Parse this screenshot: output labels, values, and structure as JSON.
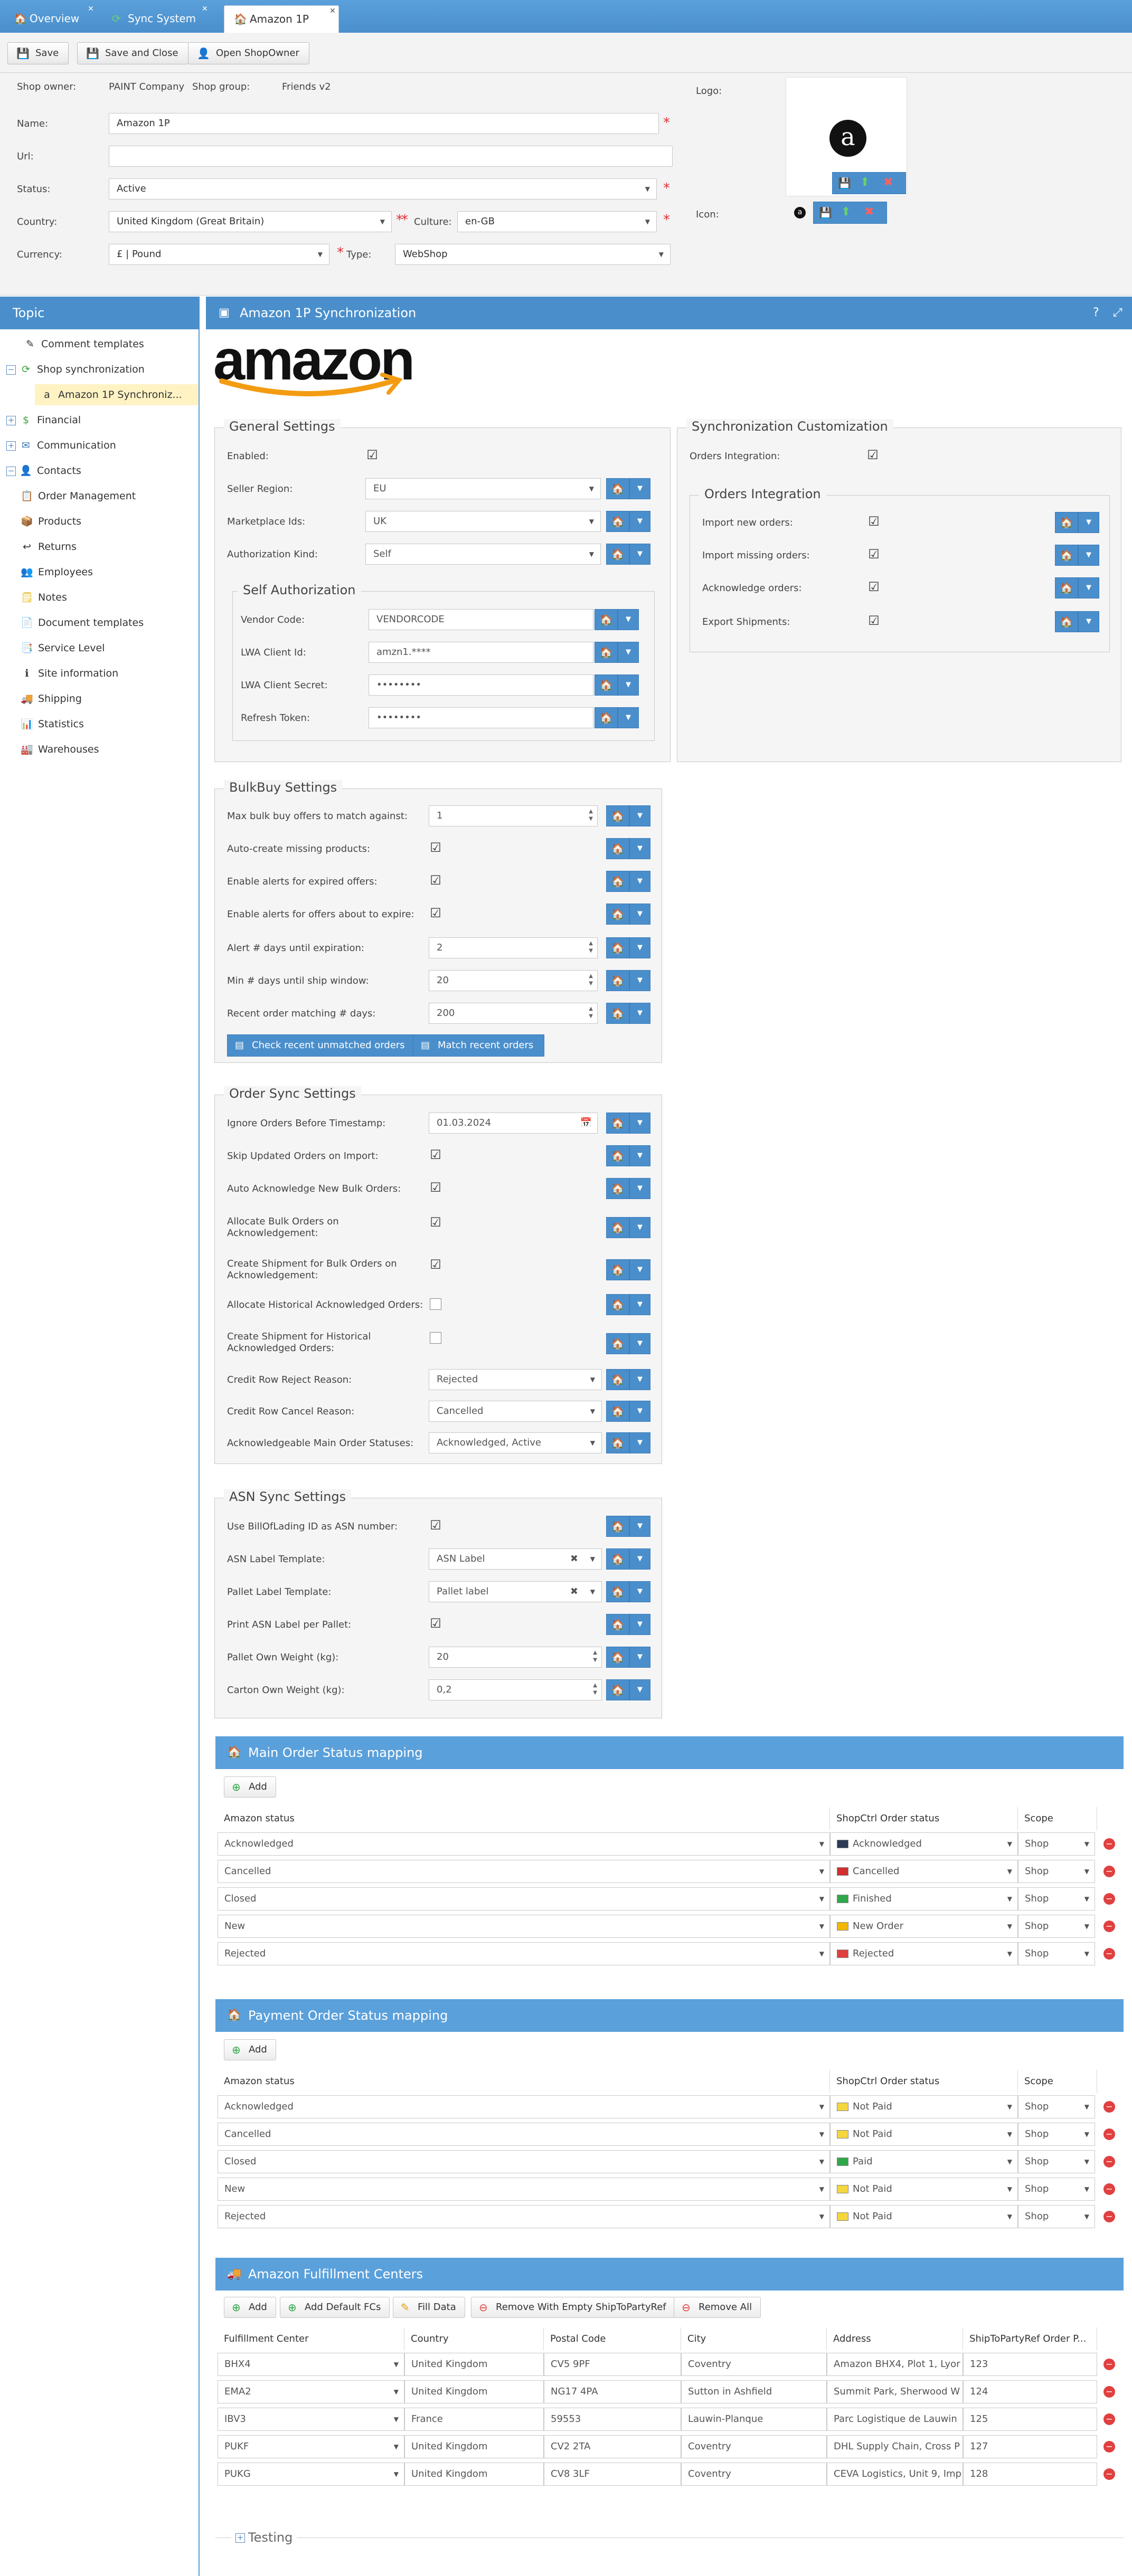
{
  "tabs": [
    {
      "label": "Overview",
      "icon": "home-icon"
    },
    {
      "label": "Sync System",
      "icon": "sync-icon"
    },
    {
      "label": "Amazon 1P",
      "icon": "home-icon"
    }
  ],
  "toolbar": {
    "save": "Save",
    "save_close": "Save and Close",
    "open_owner": "Open ShopOwner"
  },
  "header": {
    "shop_owner_label": "Shop owner:",
    "shop_owner": "PAINT Company",
    "shop_group_label": "Shop group:",
    "shop_group": "Friends v2",
    "name_label": "Name:",
    "name": "Amazon 1P",
    "url_label": "Url:",
    "url": "",
    "status_label": "Status:",
    "status": "Active",
    "country_label": "Country:",
    "country": "United Kingdom (Great Britain)",
    "culture_label": "Culture:",
    "culture": "en-GB",
    "currency_label": "Currency:",
    "currency": "£ | Pound",
    "type_label": "Type:",
    "type": "WebShop",
    "logo_label": "Logo:",
    "icon_label": "Icon:"
  },
  "sidebar": {
    "title": "Topic",
    "items": [
      {
        "label": "Comment templates"
      },
      {
        "label": "Shop synchronization"
      },
      {
        "label": "Amazon 1P Synchroniz..."
      },
      {
        "label": "Financial"
      },
      {
        "label": "Communication"
      },
      {
        "label": "Contacts"
      },
      {
        "label": "Order Management"
      },
      {
        "label": "Products"
      },
      {
        "label": "Returns"
      },
      {
        "label": "Employees"
      },
      {
        "label": "Notes"
      },
      {
        "label": "Document templates"
      },
      {
        "label": "Service Level"
      },
      {
        "label": "Site information"
      },
      {
        "label": "Shipping"
      },
      {
        "label": "Statistics"
      },
      {
        "label": "Warehouses"
      }
    ]
  },
  "main": {
    "title": "Amazon 1P Synchronization",
    "logo_text": "amazon",
    "general": {
      "legend": "General Settings",
      "enabled": "Enabled:",
      "seller_region": "Seller Region:",
      "seller_region_val": "EU",
      "marketplace": "Marketplace Ids:",
      "marketplace_val": "UK",
      "auth_kind": "Authorization Kind:",
      "auth_kind_val": "Self",
      "self_legend": "Self Authorization",
      "vendor": "Vendor Code:",
      "vendor_val": "VENDORCODE",
      "lwa_id": "LWA Client Id:",
      "lwa_id_val": "amzn1.****",
      "lwa_secret": "LWA Client Secret:",
      "lwa_secret_val": "••••••••",
      "refresh": "Refresh Token:",
      "refresh_val": "••••••••"
    },
    "sync_custom": {
      "legend": "Synchronization Customization",
      "orders_integration": "Orders Integration:",
      "oi_legend": "Orders Integration",
      "import_new": "Import new orders:",
      "import_missing": "Import missing orders:",
      "acknowledge": "Acknowledge orders:",
      "export_ship": "Export Shipments:"
    },
    "bulk": {
      "legend": "BulkBuy Settings",
      "max_offers": "Max bulk buy offers to match against:",
      "max_offers_val": "1",
      "auto_create": "Auto-create missing products:",
      "alert_expired": "Enable alerts for expired offers:",
      "alert_expire": "Enable alerts for offers about to expire:",
      "alert_days": "Alert # days until expiration:",
      "alert_days_val": "2",
      "min_days": "Min # days until ship window:",
      "min_days_val": "20",
      "recent_days": "Recent order matching # days:",
      "recent_days_val": "200",
      "check_btn": "Check recent unmatched orders",
      "match_btn": "Match recent orders"
    },
    "order_sync": {
      "legend": "Order Sync Settings",
      "ignore_before": "Ignore Orders Before Timestamp:",
      "ignore_before_val": "01.03.2024",
      "skip_updated": "Skip Updated Orders on Import:",
      "auto_ack": "Auto Acknowledge New Bulk Orders:",
      "alloc_bulk_1": "Allocate Bulk Orders on",
      "alloc_bulk_2": "Acknowledgement:",
      "create_ship_1": "Create Shipment for Bulk Orders on",
      "create_ship_2": "Acknowledgement:",
      "alloc_hist": "Allocate Historical Acknowledged Orders:",
      "create_hist_1": "Create Shipment for Historical",
      "create_hist_2": "Acknowledged Orders:",
      "reject_reason": "Credit Row Reject Reason:",
      "reject_reason_val": "Rejected",
      "cancel_reason": "Credit Row Cancel Reason:",
      "cancel_reason_val": "Cancelled",
      "ack_statuses": "Acknowledgeable Main Order Statuses:",
      "ack_statuses_val": "Acknowledged, Active"
    },
    "asn": {
      "legend": "ASN Sync Settings",
      "use_bol": "Use BillOfLading ID as ASN number:",
      "asn_label": "ASN Label Template:",
      "asn_label_val": "ASN Label",
      "pallet_label": "Pallet Label Template:",
      "pallet_label_val": "Pallet label",
      "print_asn": "Print ASN Label per Pallet:",
      "pallet_weight": "Pallet Own Weight (kg):",
      "pallet_weight_val": "20",
      "carton_weight": "Carton Own Weight (kg):",
      "carton_weight_val": "0,2"
    },
    "main_status": {
      "title": "Main Order Status mapping",
      "add": "Add",
      "cols": [
        "Amazon status",
        "ShopCtrl Order status",
        "Scope"
      ],
      "rows": [
        {
          "amazon": "Acknowledged",
          "shop": "Acknowledged",
          "scope": "Shop",
          "color": "#2b3a55"
        },
        {
          "amazon": "Cancelled",
          "shop": "Cancelled",
          "scope": "Shop",
          "color": "#d03030"
        },
        {
          "amazon": "Closed",
          "shop": "Finished",
          "scope": "Shop",
          "color": "#2fa84a"
        },
        {
          "amazon": "New",
          "shop": "New Order",
          "scope": "Shop",
          "color": "#f2b705"
        },
        {
          "amazon": "Rejected",
          "shop": "Rejected",
          "scope": "Shop",
          "color": "#e04040"
        }
      ]
    },
    "payment_status": {
      "title": "Payment Order Status mapping",
      "add": "Add",
      "cols": [
        "Amazon status",
        "ShopCtrl Order status",
        "Scope"
      ],
      "rows": [
        {
          "amazon": "Acknowledged",
          "shop": "Not Paid",
          "scope": "Shop",
          "color": "#f5d63d"
        },
        {
          "amazon": "Cancelled",
          "shop": "Not Paid",
          "scope": "Shop",
          "color": "#f5d63d"
        },
        {
          "amazon": "Closed",
          "shop": "Paid",
          "scope": "Shop",
          "color": "#2fa84a"
        },
        {
          "amazon": "New",
          "shop": "Not Paid",
          "scope": "Shop",
          "color": "#f5d63d"
        },
        {
          "amazon": "Rejected",
          "shop": "Not Paid",
          "scope": "Shop",
          "color": "#f5d63d"
        }
      ]
    },
    "fc": {
      "title": "Amazon Fulfillment Centers",
      "add": "Add",
      "add_default": "Add Default FCs",
      "fill": "Fill Data",
      "remove_empty": "Remove With Empty ShipToPartyRef",
      "remove_all": "Remove All",
      "cols": [
        "Fulfillment Center",
        "Country",
        "Postal Code",
        "City",
        "Address",
        "ShipToPartyRef Order P..."
      ],
      "rows": [
        {
          "fc": "BHX4",
          "country": "United Kingdom",
          "postal": "CV5 9PF",
          "city": "Coventry",
          "address": "Amazon BHX4, Plot 1, Lyor",
          "ref": "123"
        },
        {
          "fc": "EMA2",
          "country": "United Kingdom",
          "postal": "NG17 4PA",
          "city": "Sutton in Ashfield",
          "address": "Summit Park, Sherwood W",
          "ref": "124"
        },
        {
          "fc": "IBV3",
          "country": "France",
          "postal": "59553",
          "city": "Lauwin-Planque",
          "address": "Parc Logistique de Lauwin",
          "ref": "125"
        },
        {
          "fc": "PUKF",
          "country": "United Kingdom",
          "postal": "CV2 2TA",
          "city": "Coventry",
          "address": "DHL Supply Chain, Cross P",
          "ref": "127"
        },
        {
          "fc": "PUKG",
          "country": "United Kingdom",
          "postal": "CV8 3LF",
          "city": "Coventry",
          "address": "CEVA Logistics, Unit 9, Imp",
          "ref": "128"
        }
      ]
    },
    "testing": "Testing"
  }
}
